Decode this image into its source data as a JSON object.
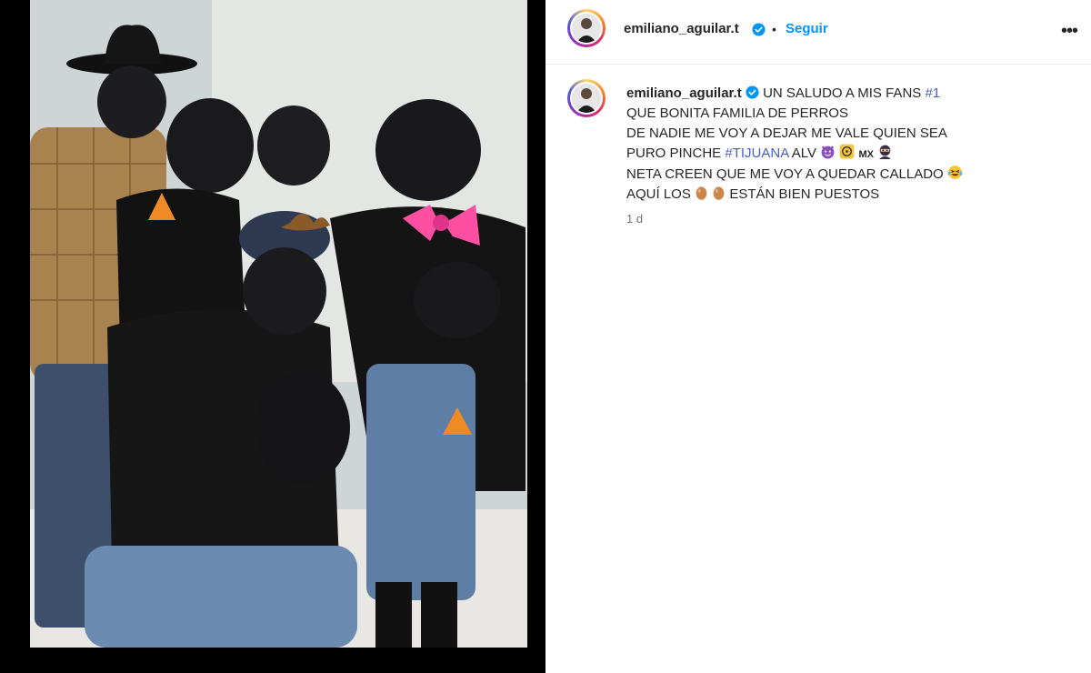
{
  "post": {
    "author": {
      "username": "emiliano_aguilar.t",
      "verified": true
    },
    "header": {
      "separator": "•",
      "follow_label": "Seguir",
      "more_icon": "more-options-icon"
    },
    "caption": {
      "username": "emiliano_aguilar.t",
      "line1_text": "UN SALUDO A MIS FANS ",
      "line1_hashtag": "#1",
      "line2_text": "QUE BONITA FAMILIA DE PERROS",
      "line3_text": "DE NADIE ME VOY A DEJAR ME VALE QUIEN SEA",
      "line4_text": "PURO PINCHE ",
      "line4_hashtag": "#TIJUANA",
      "line4_suffix": " ALV",
      "line4_flag_text": "MX",
      "line5_text": "NETA CREEN QUE ME VOY A QUEDAR CALLADO",
      "line6_prefix": "AQUÍ LOS",
      "line6_suffix": "ESTÁN BIEN PUESTOS"
    },
    "timestamp": "1 d",
    "media": {
      "description_icon": "photo-image"
    }
  },
  "colors": {
    "link": "#0095f6",
    "hashtag": "#4a5cc9",
    "verified": "#0095f6",
    "text": "#262626",
    "muted": "#737373"
  }
}
